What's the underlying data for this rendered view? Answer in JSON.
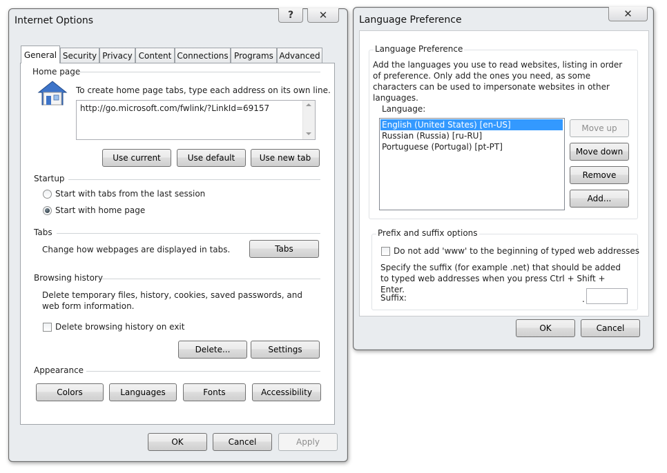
{
  "internet_options": {
    "title": "Internet Options",
    "help_icon": "question-icon",
    "close_icon": "close-icon",
    "tabs": [
      {
        "label": "General",
        "active": true
      },
      {
        "label": "Security"
      },
      {
        "label": "Privacy"
      },
      {
        "label": "Content"
      },
      {
        "label": "Connections"
      },
      {
        "label": "Programs"
      },
      {
        "label": "Advanced"
      }
    ],
    "home_page": {
      "group_label": "Home page",
      "instruction": "To create home page tabs, type each address on its own line.",
      "url": "http://go.microsoft.com/fwlink/?LinkId=69157",
      "use_current": "Use current",
      "use_default": "Use default",
      "use_new_tab": "Use new tab"
    },
    "startup": {
      "group_label": "Startup",
      "option_tabs": "Start with tabs from the last session",
      "option_home": "Start with home page",
      "selected": "Start with home page"
    },
    "tabs_section": {
      "group_label": "Tabs",
      "description": "Change how webpages are displayed in tabs.",
      "button": "Tabs"
    },
    "browsing_history": {
      "group_label": "Browsing history",
      "description": "Delete temporary files, history, cookies, saved passwords, and web form information.",
      "checkbox_label": "Delete browsing history on exit",
      "checked": false,
      "delete_button": "Delete...",
      "settings_button": "Settings"
    },
    "appearance": {
      "group_label": "Appearance",
      "colors": "Colors",
      "languages": "Languages",
      "fonts": "Fonts",
      "accessibility": "Accessibility"
    },
    "footer": {
      "ok": "OK",
      "cancel": "Cancel",
      "apply": "Apply"
    }
  },
  "language_preference": {
    "title": "Language Preference",
    "close_icon": "close-icon",
    "group_label": "Language Preference",
    "description": "Add the languages you use to read websites, listing in order of preference. Only add the ones you need, as some characters can be used to impersonate websites in other languages.",
    "language_label": "Language:",
    "languages": [
      {
        "label": "English (United States) [en-US]",
        "selected": true
      },
      {
        "label": "Russian (Russia) [ru-RU]"
      },
      {
        "label": "Portuguese (Portugal) [pt-PT]"
      }
    ],
    "move_up": "Move up",
    "move_down": "Move down",
    "remove": "Remove",
    "add": "Add...",
    "prefix_group_label": "Prefix and suffix options",
    "www_checkbox_label": "Do not add 'www' to the beginning of typed web addresses",
    "www_checked": false,
    "suffix_description": "Specify the suffix (for example .net) that should be added to typed web addresses when you press Ctrl + Shift + Enter.",
    "suffix_label": "Suffix:",
    "suffix_dot": ".",
    "suffix_value": "",
    "ok": "OK",
    "cancel": "Cancel"
  },
  "colors": {
    "selection": "#3399ff",
    "window_frame": "#e9ecef",
    "disabled_text": "#8d8d8d"
  }
}
